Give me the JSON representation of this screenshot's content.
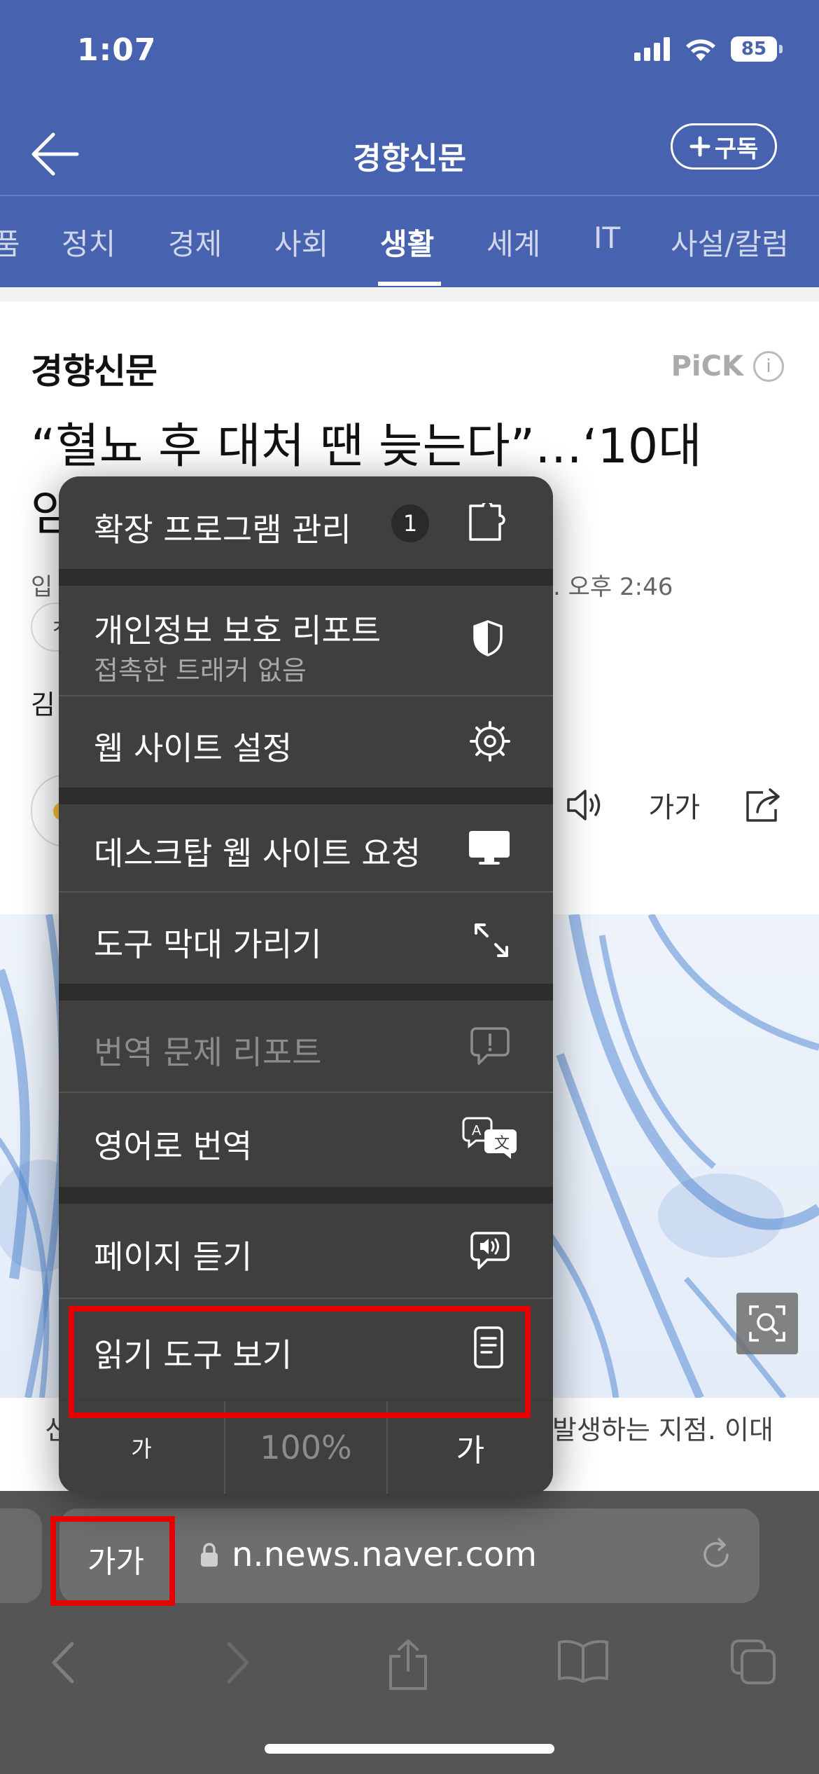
{
  "status_bar": {
    "time": "1:07",
    "battery": "85"
  },
  "nav": {
    "title": "경향신문",
    "subscribe_label": "구독"
  },
  "categories": [
    "품",
    "정치",
    "경제",
    "사회",
    "생활",
    "세계",
    "IT",
    "사설/칼럼"
  ],
  "active_category": "생활",
  "article": {
    "press_name": "경향신문",
    "pick_label": "PiCK",
    "headline_line1": "“혈뇨 후 대처 땐 늦는다”…‘10대",
    "headline_line2_fragment": "암",
    "meta_prefix": "입",
    "meta_time": ". 오후 2:46",
    "tag_fragment": "ㅊ",
    "reporter_fragment": "김",
    "font_size_tool": "가가",
    "caption_left": "신",
    "caption_right": "발생하는 지점. 이대"
  },
  "menu": {
    "items": [
      {
        "label": "확장 프로그램 관리",
        "badge": "1",
        "icon": "puzzle-icon"
      },
      {
        "label": "개인정보 보호 리포트",
        "sublabel": "접촉한 트래커 없음",
        "icon": "shield-icon"
      },
      {
        "label": "웹 사이트 설정",
        "icon": "gear-icon"
      },
      {
        "label": "데스크탑 웹 사이트 요청",
        "icon": "monitor-icon"
      },
      {
        "label": "도구 막대 가리기",
        "icon": "expand-arrows-icon"
      },
      {
        "label": "번역 문제 리포트",
        "icon": "report-bubble-icon",
        "disabled": true
      },
      {
        "label": "영어로 번역",
        "icon": "translate-icon"
      },
      {
        "label": "페이지 듣기",
        "icon": "speaker-bubble-icon"
      },
      {
        "label": "읽기 도구 보기",
        "icon": "reader-icon"
      }
    ],
    "zoom": {
      "smaller": "가",
      "level": "100%",
      "larger": "가"
    }
  },
  "toolbar": {
    "aa_label": "가가",
    "url": "n.news.naver.com"
  },
  "colors": {
    "header_bg": "#4762ae",
    "highlight": "#e60000"
  }
}
